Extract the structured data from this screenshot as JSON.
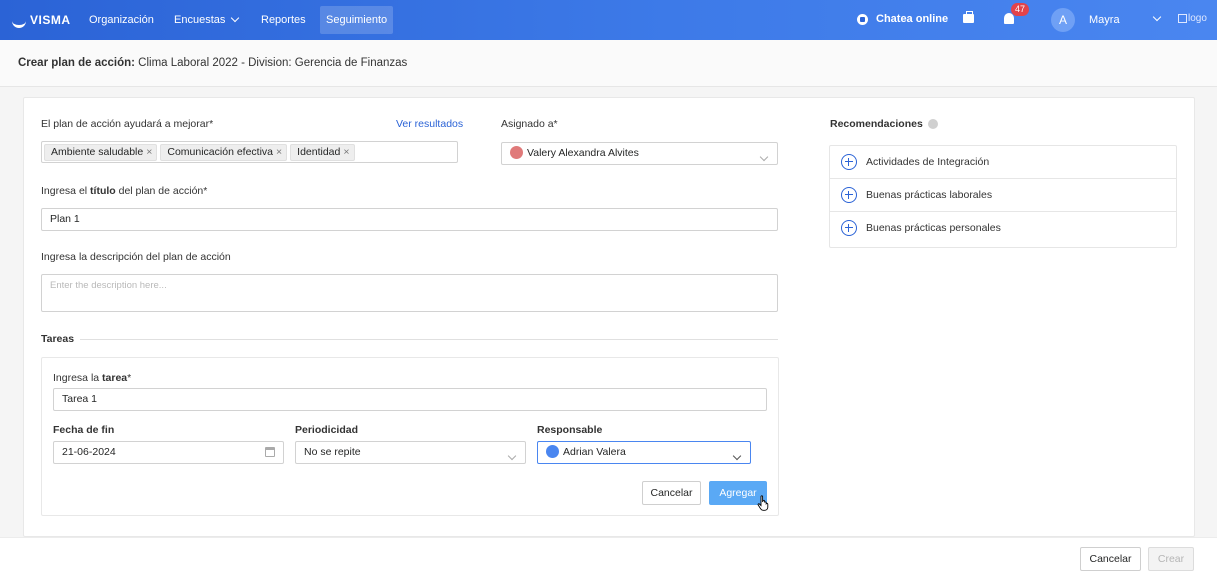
{
  "topbar": {
    "brand": "VISMA",
    "nav": [
      "Organización",
      "Encuestas",
      "Reportes",
      "Seguimiento"
    ],
    "chat_label": "Chatea online",
    "notifications_count": "47",
    "avatar_initial": "A",
    "user_name": "Mayra",
    "logo_alt": "logo"
  },
  "breadcrumb": {
    "prefix": "Crear plan de acción:",
    "text": "Clima Laboral 2022 - Division: Gerencia de Finanzas"
  },
  "form": {
    "improve_label": "El plan de acción ayudará a mejorar*",
    "see_results": "Ver resultados",
    "tags": [
      "Ambiente saludable",
      "Comunicación efectiva",
      "Identidad"
    ],
    "assigned_label": "Asignado a*",
    "assigned_value": "Valery Alexandra Alvites",
    "title_label_pre": "Ingresa el ",
    "title_label_bold": "título",
    "title_label_post": " del plan de acción*",
    "title_value": "Plan 1",
    "description_label": "Ingresa la descripción del plan de acción",
    "description_placeholder": "Enter the description here...",
    "tasks_heading": "Tareas"
  },
  "task": {
    "task_label_pre": "Ingresa la ",
    "task_label_bold": "tarea",
    "task_label_post": "*",
    "task_value": "Tarea 1",
    "end_date_label": "Fecha de fin",
    "end_date_value": "21-06-2024",
    "periodicity_label": "Periodicidad",
    "periodicity_value": "No se repite",
    "responsible_label": "Responsable",
    "responsible_value": "Adrian Valera",
    "cancel": "Cancelar",
    "add": "Agregar"
  },
  "recommendations": {
    "title": "Recomendaciones",
    "items": [
      "Actividades de Integración",
      "Buenas prácticas laborales",
      "Buenas prácticas personales"
    ]
  },
  "footer": {
    "cancel": "Cancelar",
    "create": "Crear"
  },
  "colors": {
    "primary": "#2b63d6",
    "accent_button": "#5aa9f5",
    "badge": "#e2434a"
  }
}
